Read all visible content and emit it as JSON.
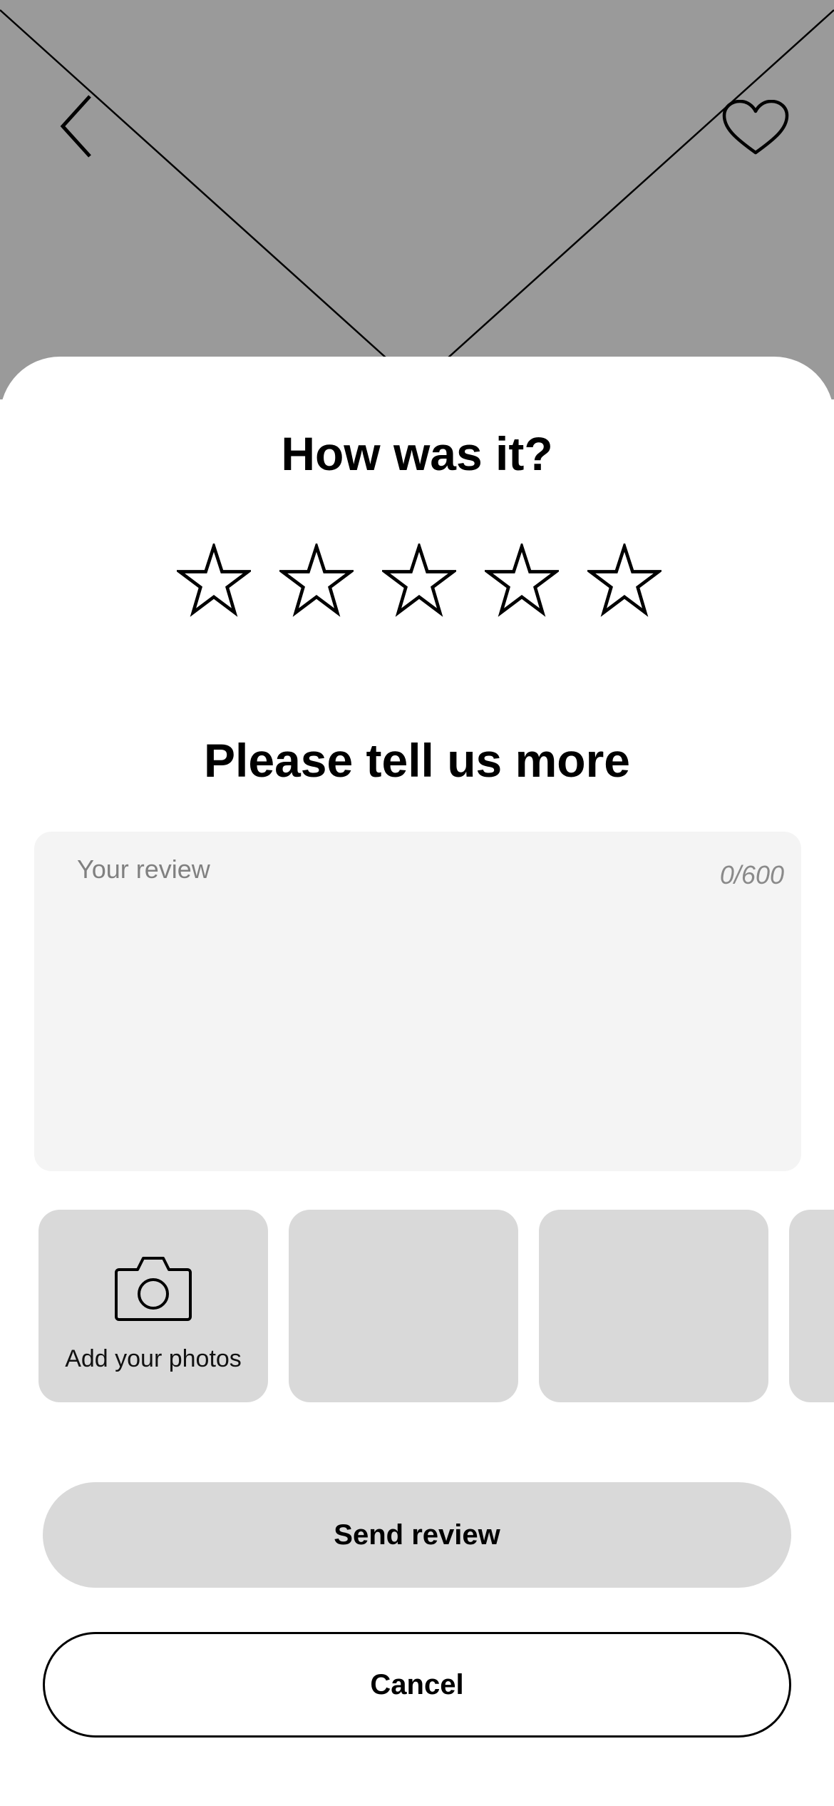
{
  "rating": {
    "title": "How was it?",
    "max_stars": 5,
    "selected_stars": 0
  },
  "review": {
    "title": "Please tell us more",
    "placeholder": "Your review",
    "value": "",
    "counter": "0/600"
  },
  "photos": {
    "add_label": "Add your photos"
  },
  "actions": {
    "send_label": "Send review",
    "cancel_label": "Cancel"
  },
  "icons": {
    "back": "back-icon",
    "favorite": "heart-icon",
    "star": "star-outline-icon",
    "camera": "camera-icon"
  },
  "colors": {
    "hero_placeholder": "#9a9a9a",
    "tile": "#d9d9d9",
    "input_bg": "#f4f4f4"
  }
}
